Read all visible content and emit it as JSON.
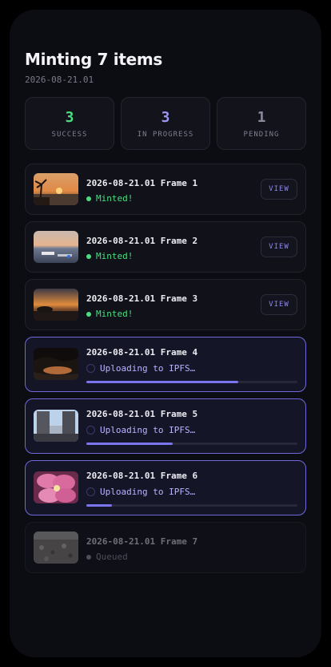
{
  "header": {
    "title": "Minting 7 items",
    "subtitle": "2026-08-21.01"
  },
  "stats": [
    {
      "value": "3",
      "label": "SUCCESS",
      "color": "#4ade80"
    },
    {
      "value": "3",
      "label": "IN PROGRESS",
      "color": "#9b95f5"
    },
    {
      "value": "1",
      "label": "PENDING",
      "color": "#8a8a9a"
    }
  ],
  "items": [
    {
      "name": "2026-08-21.01 Frame 1",
      "status": "Minted!",
      "state": "minted",
      "view_label": "VIEW"
    },
    {
      "name": "2026-08-21.01 Frame 2",
      "status": "Minted!",
      "state": "minted",
      "view_label": "VIEW"
    },
    {
      "name": "2026-08-21.01 Frame 3",
      "status": "Minted!",
      "state": "minted",
      "view_label": "VIEW"
    },
    {
      "name": "2026-08-21.01 Frame 4",
      "status": "Uploading to IPFS…",
      "state": "uploading",
      "progress": 0.72
    },
    {
      "name": "2026-08-21.01 Frame 5",
      "status": "Uploading to IPFS…",
      "state": "uploading",
      "progress": 0.41
    },
    {
      "name": "2026-08-21.01 Frame 6",
      "status": "Uploading to IPFS…",
      "state": "uploading",
      "progress": 0.12
    },
    {
      "name": "2026-08-21.01 Frame 7",
      "status": "Queued",
      "state": "queued"
    }
  ],
  "colors": {
    "minted": "#4ade80",
    "uploading": "#b8b4ff",
    "queued": "#7a7a8a",
    "accent": "#7b74ec"
  }
}
